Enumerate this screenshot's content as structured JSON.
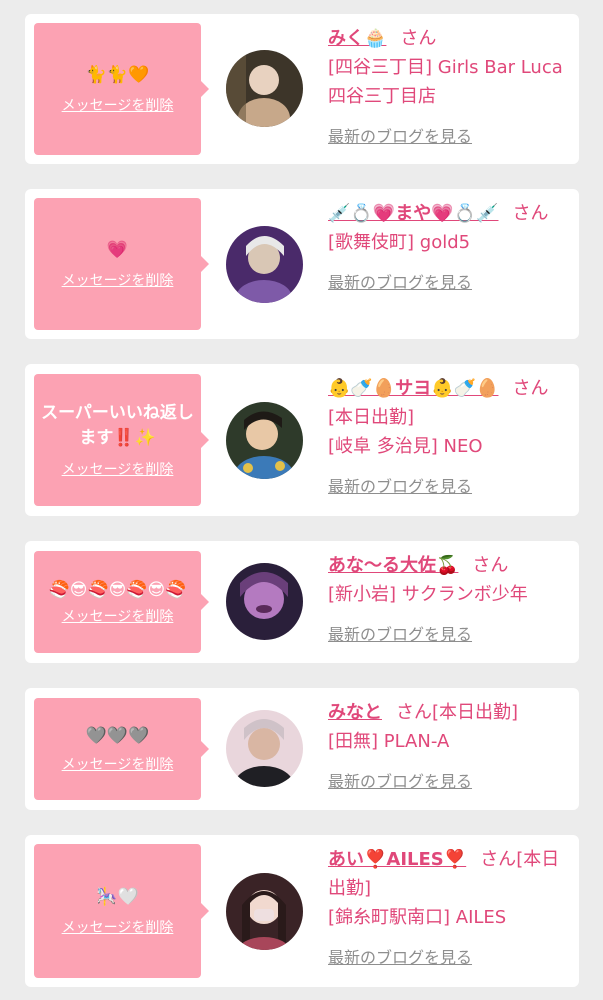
{
  "delete_label": "メッセージを削除",
  "blog_label": "最新のブログを見る",
  "san_label": "さん",
  "cards": [
    {
      "message": "🐈🐈🧡",
      "name": "みく🧁",
      "suffix": "",
      "detail": "[四谷三丁目] Girls Bar Luca 四谷三丁目店",
      "avatar_icon": "avatar-photo-1",
      "avatar_colors": [
        "#3d3529",
        "#c7a88a",
        "#6b5a41"
      ]
    },
    {
      "message": "💗",
      "name": "💉💍💗まや💗💍💉",
      "suffix": "",
      "detail": "[歌舞伎町] gold5",
      "avatar_icon": "avatar-photo-2",
      "avatar_colors": [
        "#4a2a6a",
        "#d9c7b5",
        "#7e5aa8"
      ]
    },
    {
      "message": "スーパーいいね返します‼️✨",
      "name": "👶🍼🥚サヨ👶🍼🥚",
      "suffix": "[本日出勤]",
      "detail": "[岐阜 多治見] NEO",
      "avatar_icon": "avatar-photo-3",
      "avatar_colors": [
        "#2e3a2a",
        "#e8c8a6",
        "#3b7ab8"
      ]
    },
    {
      "message": "🍣😎🍣😎🍣😎🍣",
      "name": "あな〜る大佐🍒",
      "suffix": "",
      "detail": "[新小岩] サクランボ少年",
      "avatar_icon": "avatar-photo-4",
      "avatar_colors": [
        "#2a1f3a",
        "#b47ac0",
        "#6a3f7a"
      ]
    },
    {
      "message": "🩶🩶🩶",
      "name": "みなと",
      "suffix": "[本日出勤]",
      "detail": "[田無] PLAN-A",
      "avatar_icon": "avatar-photo-5",
      "avatar_colors": [
        "#e9d6dc",
        "#d9b6a3",
        "#1f1f24"
      ]
    },
    {
      "message": "🎠🤍",
      "name": "あい❣️AILES❣️",
      "suffix": "[本日出勤]",
      "detail": "[錦糸町駅南口] AILES",
      "avatar_icon": "avatar-photo-6",
      "avatar_colors": [
        "#3a2326",
        "#eedfe0",
        "#a8465a"
      ]
    }
  ]
}
